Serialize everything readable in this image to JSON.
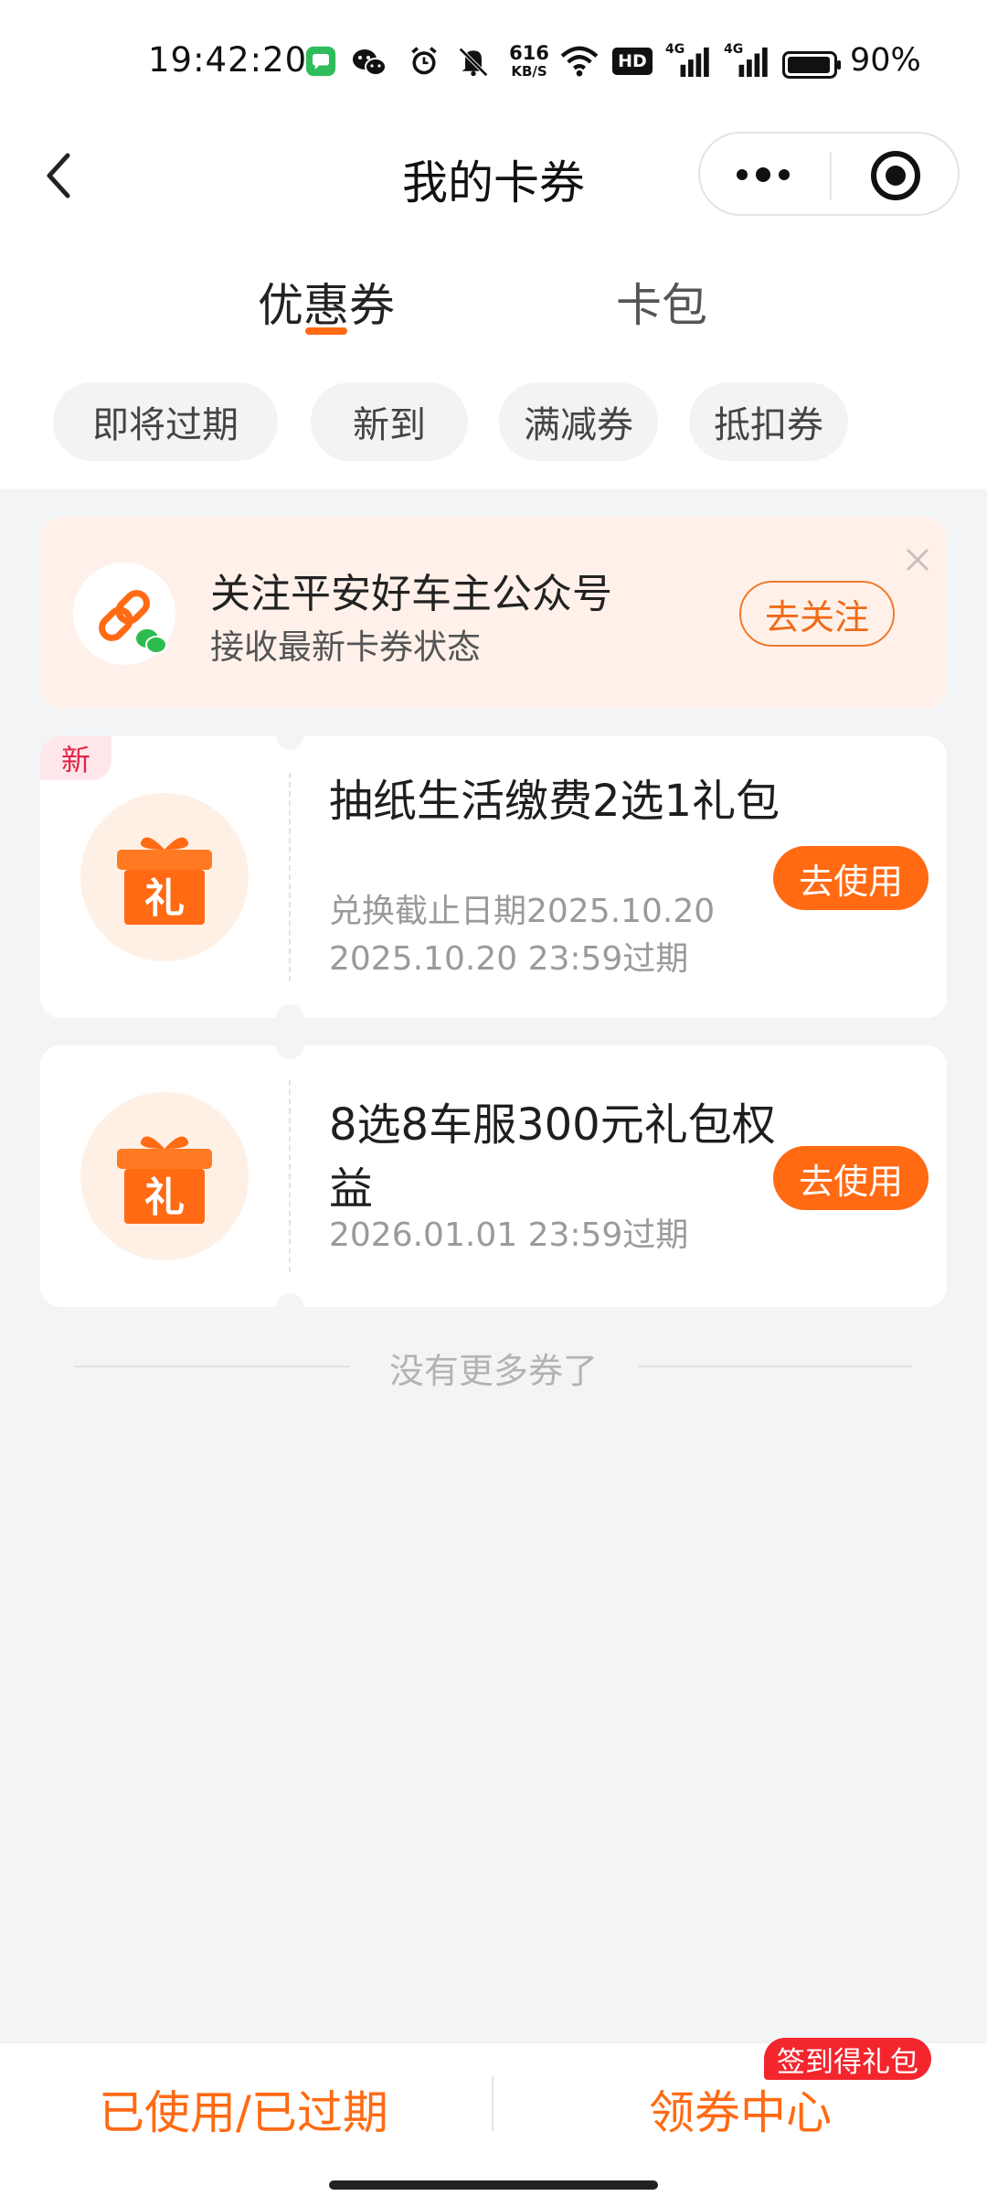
{
  "status_bar": {
    "time": "19:42:20",
    "net_speed_value": "616",
    "net_speed_unit": "KB/S",
    "hd_label": "HD",
    "signal1_label": "4G",
    "signal2_label": "4G",
    "battery": "90%",
    "icons": [
      "messages-icon",
      "wechat-icon",
      "alarm-icon",
      "mute-icon",
      "wifi-icon",
      "hd-icon",
      "signal-icon",
      "battery-icon"
    ]
  },
  "nav": {
    "title": "我的卡券"
  },
  "tabs": [
    {
      "label": "优惠券",
      "active": true
    },
    {
      "label": "卡包",
      "active": false
    }
  ],
  "filters": [
    "即将过期",
    "新到",
    "满减券",
    "抵扣券"
  ],
  "banner": {
    "title": "关注平安好车主公众号",
    "subtitle": "接收最新卡券状态",
    "button": "去关注"
  },
  "coupons": [
    {
      "badge": "新",
      "icon_label": "礼",
      "title": "抽纸生活缴费2选1礼包",
      "redeem_deadline": "兑换截止日期2025.10.20",
      "expiry": "2025.10.20 23:59过期",
      "button": "去使用"
    },
    {
      "icon_label": "礼",
      "title": "8选8车服300元礼包权益",
      "expiry": "2026.01.01 23:59过期",
      "button": "去使用"
    }
  ],
  "no_more_text": "没有更多券了",
  "bottom_bar": {
    "left_link": "已使用/已过期",
    "right_link": "领券中心",
    "right_badge": "签到得礼包"
  },
  "colors": {
    "accent": "#ff6a13",
    "badge_red": "#f3262e",
    "background": "#f3f4f6"
  }
}
